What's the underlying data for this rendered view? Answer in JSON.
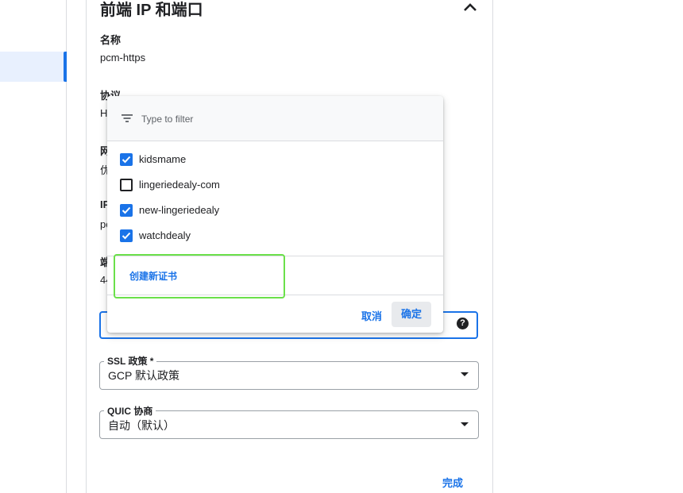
{
  "panel": {
    "title": "前端 IP 和端口",
    "name_label": "名称",
    "name_value": "pcm-https",
    "protocol_label": "协议",
    "protocol_value_partial": "H",
    "network_label_partial": "网",
    "network_value_partial": "优",
    "ip_label_partial": "IP",
    "ip_value_partial": "pc",
    "port_label_partial": "端",
    "port_value_partial": "44",
    "ssl_policy": {
      "label": "SSL 政策 *",
      "value": "GCP 默认政策"
    },
    "quic": {
      "label": "QUIC 协商",
      "value": "自动（默认）"
    },
    "done_label": "完成",
    "help_glyph": "?"
  },
  "popup": {
    "filter_placeholder": "Type to filter",
    "options": [
      {
        "label": "kidsmame",
        "checked": true
      },
      {
        "label": "lingeriedealy-com",
        "checked": false
      },
      {
        "label": "new-lingeriedealy",
        "checked": true
      },
      {
        "label": "watchdealy",
        "checked": true
      }
    ],
    "create_label": "创建新证书",
    "cancel_label": "取消",
    "ok_label": "确定"
  },
  "colors": {
    "accent": "#1a73e8",
    "highlight": "#6be04a",
    "text": "#202124",
    "divider": "#dadce0"
  }
}
